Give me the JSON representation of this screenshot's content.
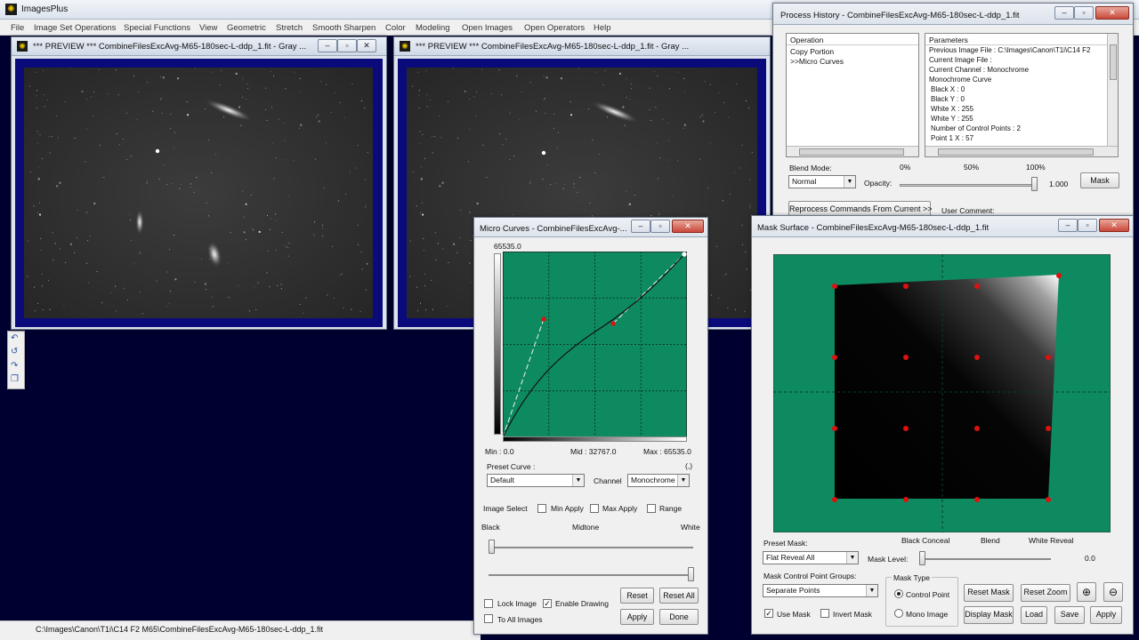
{
  "app": {
    "title": "ImagesPlus",
    "status_path": "C:\\Images\\Canon\\T1i\\C14 F2 M65\\CombineFilesExcAvg-M65-180sec-L-ddp_1.fit",
    "menu": [
      "File",
      "Image Set Operations",
      "Special Functions",
      "View",
      "Geometric",
      "Stretch",
      "Smooth Sharpen",
      "Color",
      "Modeling",
      "Open Images",
      "Open Operators",
      "Help"
    ]
  },
  "preview_left": {
    "title": "*** PREVIEW *** CombineFilesExcAvg-M65-180sec-L-ddp_1.fit - Gray ..."
  },
  "preview_right": {
    "title": "*** PREVIEW *** CombineFilesExcAvg-M65-180sec-L-ddp_1.fit - Gray ..."
  },
  "process_history": {
    "title": "Process History - CombineFilesExcAvg-M65-180sec-L-ddp_1.fit",
    "operation_header": "Operation",
    "parameters_header": "Parameters",
    "operations": [
      "Copy Portion",
      ">>Micro Curves"
    ],
    "parameters": [
      "Previous Image File : C:\\Images\\Canon\\T1i\\C14 F2",
      "Current Image File :",
      "Current Channel : Monochrome",
      "Monochrome Curve",
      "Black X : 0",
      "Black Y : 0",
      "White X : 255",
      "White Y : 255",
      "Number of Control Points : 2",
      "Point 1 X : 57"
    ],
    "blend_mode_label": "Blend Mode:",
    "blend_mode_value": "Normal",
    "opacity_label": "Opacity:",
    "pct0": "0%",
    "pct50": "50%",
    "pct100": "100%",
    "opacity_value": "1.000",
    "mask_button": "Mask",
    "reprocess_button": "Reprocess Commands From Current >>",
    "user_comment": "User Comment:"
  },
  "micro_curves": {
    "title": "Micro Curves - CombineFilesExcAvg-...",
    "top_value": "65535.0",
    "min_label": "Min : 0.0",
    "mid_label": "Mid : 32767.0",
    "max_label": "Max : 65535.0",
    "paren": "(,)",
    "preset_label": "Preset Curve :",
    "preset_value": "Default",
    "channel_label": "Channel",
    "channel_value": "Monochrome",
    "image_select": "Image Select",
    "min_apply": "Min Apply",
    "max_apply": "Max Apply",
    "range": "Range",
    "black": "Black",
    "midtone": "Midtone",
    "white": "White",
    "lock_image": "Lock Image",
    "enable_drawing": "Enable Drawing",
    "to_all_images": "To All Images",
    "reset": "Reset",
    "reset_all": "Reset All",
    "apply": "Apply",
    "done": "Done"
  },
  "mask_surface": {
    "title": "Mask Surface - CombineFilesExcAvg-M65-180sec-L-ddp_1.fit",
    "preset_mask_label": "Preset Mask:",
    "preset_mask_value": "Flat Reveal All",
    "black_conceal": "Black Conceal",
    "blend": "Blend",
    "white_reveal": "White Reveal",
    "mask_level_label": "Mask Level:",
    "mask_level_value": "0.0",
    "groups_label": "Mask Control Point Groups:",
    "groups_value": "Separate Points",
    "mask_type_label": "Mask Type",
    "control_point": "Control Point",
    "mono_image": "Mono Image",
    "use_mask": "Use Mask",
    "invert_mask": "Invert Mask",
    "reset_mask": "Reset Mask",
    "reset_zoom": "Reset Zoom",
    "display_mask": "Display Mask",
    "load": "Load",
    "save": "Save",
    "apply": "Apply"
  },
  "colors": {
    "desktop": "#000030",
    "curve_bg": "#0d8a60",
    "preview_frame": "#0a0a7a",
    "control_point": "#e01010"
  }
}
